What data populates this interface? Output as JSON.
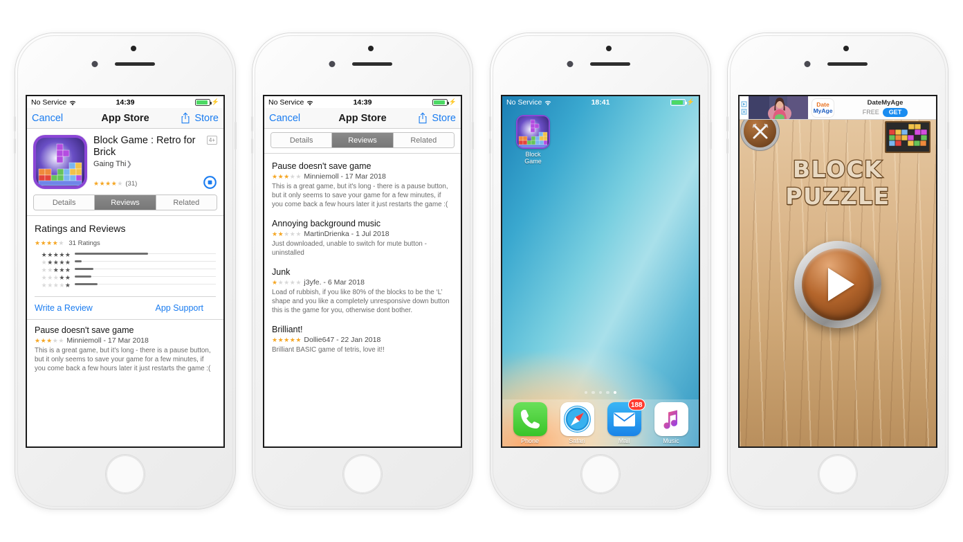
{
  "phones": [
    {
      "id": "phone-appstore-reviews-summary",
      "statusbar": {
        "carrier": "No Service",
        "time": "14:39",
        "wifi_icon": "wifi-icon",
        "battery_icon": "battery-icon",
        "charging_icon": "charging-bolt-icon"
      },
      "navbar": {
        "cancel": "Cancel",
        "title": "App Store",
        "share_icon": "share-icon",
        "store": "Store"
      },
      "app": {
        "name": "Block Game : Retro for Brick",
        "developer": "Gaing Thi",
        "age_rating": "4+",
        "stars": 3.5,
        "rating_count": "(31)",
        "download_state_icon": "stop-download-icon"
      },
      "segments": [
        {
          "label": "Details",
          "active": false
        },
        {
          "label": "Reviews",
          "active": true
        },
        {
          "label": "Related",
          "active": false
        }
      ],
      "ratings_section": {
        "title": "Ratings and Reviews",
        "stars": 3.5,
        "count_label": "31 Ratings",
        "bars": [
          {
            "stars": 5,
            "pct": 52
          },
          {
            "stars": 4,
            "pct": 5
          },
          {
            "stars": 3,
            "pct": 13
          },
          {
            "stars": 2,
            "pct": 12
          },
          {
            "stars": 1,
            "pct": 16
          }
        ]
      },
      "actions": {
        "write_review": "Write a Review",
        "app_support": "App Support"
      },
      "review": {
        "title": "Pause doesn't save game",
        "stars": 3,
        "author": "Minniemoll - 17 Mar 2018",
        "body": "This is a great game, but it's long - there is a pause button, but it only seems to save your game for a few minutes, if you come back a few hours later it just restarts the game :("
      }
    },
    {
      "id": "phone-appstore-review-list",
      "statusbar": {
        "carrier": "No Service",
        "time": "14:39",
        "wifi_icon": "wifi-icon",
        "battery_icon": "battery-icon",
        "charging_icon": "charging-bolt-icon"
      },
      "navbar": {
        "cancel": "Cancel",
        "title": "App Store",
        "share_icon": "share-icon",
        "store": "Store"
      },
      "segments": [
        {
          "label": "Details",
          "active": false
        },
        {
          "label": "Reviews",
          "active": true
        },
        {
          "label": "Related",
          "active": false
        }
      ],
      "reviews": [
        {
          "title": "Pause doesn't save game",
          "stars": 3,
          "author": "Minniemoll - 17 Mar 2018",
          "body": "This is a great game, but it's long - there is a pause button, but it only seems to save your game for a few minutes, if you come back a few hours later it just restarts the game :("
        },
        {
          "title": "Annoying background music",
          "stars": 2,
          "author": "MartinDrienka - 1 Jul 2018",
          "body": "Just downloaded, unable to switch for mute button - uninstalled"
        },
        {
          "title": "Junk",
          "stars": 1,
          "author": "j3yfe. - 6 Mar 2018",
          "body": "Load of rubbish, if you like 80% of the blocks to be the ‘L’ shape and you like a completely unresponsive down button this is the game for you, otherwise dont bother."
        },
        {
          "title": "Brilliant!",
          "stars": 5,
          "author": "Dollie647 - 22 Jan 2018",
          "body": "Brilliant BASIC game of tetris, love it!!"
        }
      ]
    },
    {
      "id": "phone-home-screen",
      "statusbar": {
        "carrier": "No Service",
        "time": "18:41",
        "wifi_icon": "wifi-icon",
        "battery_icon": "battery-icon",
        "charging_icon": "charging-bolt-icon"
      },
      "home_icon": {
        "label": "Block Game",
        "icon": "block-game-app-icon"
      },
      "page_dots": {
        "count": 5,
        "active_index": 4
      },
      "dock": [
        {
          "label": "Phone",
          "icon": "phone-app-icon",
          "badge": null
        },
        {
          "label": "Safari",
          "icon": "safari-app-icon",
          "badge": null
        },
        {
          "label": "Mail",
          "icon": "mail-app-icon",
          "badge": "188"
        },
        {
          "label": "Music",
          "icon": "music-app-icon",
          "badge": null
        }
      ]
    },
    {
      "id": "phone-game-screen",
      "ad": {
        "info_icon": "ad-info-icon",
        "close_icon": "ad-close-icon",
        "logo_line1": "Date",
        "logo_line2": "MyAge",
        "name": "DateMyAge",
        "price": "FREE",
        "cta": "GET"
      },
      "game": {
        "title": "BLOCK PUZZLE",
        "sword_button_icon": "crossed-swords-icon",
        "play_button_icon": "play-triangle-icon",
        "blocks_decor_icon": "tetris-blocks-icon"
      }
    }
  ],
  "colors": {
    "ios_blue": "#1a7cf0",
    "star_orange": "#f5a623",
    "badge_red": "#ff3b30",
    "battery_green": "#4cd964",
    "get_blue": "#1a8cf0"
  }
}
